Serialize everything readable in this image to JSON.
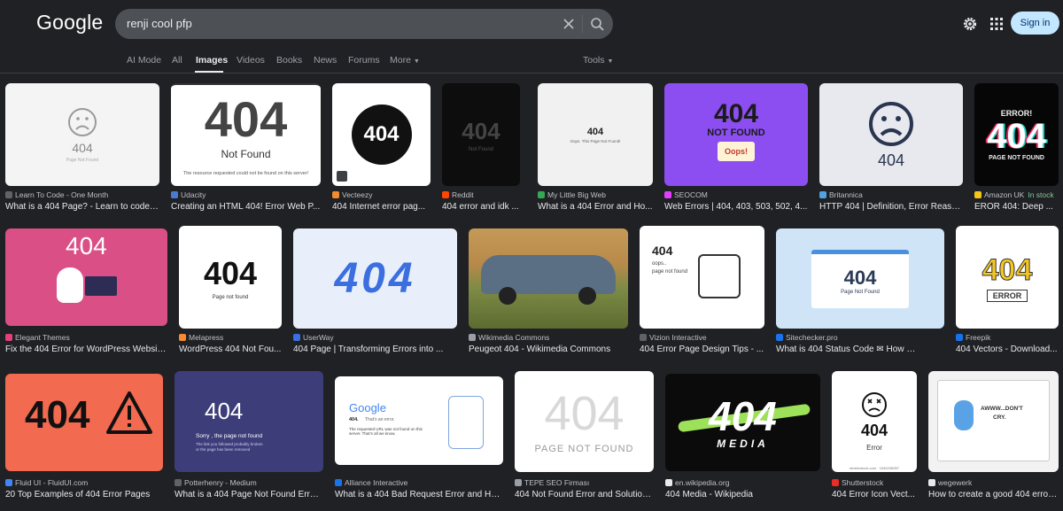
{
  "header": {
    "logo": "Google",
    "query": "renji cool pfp",
    "signin": "Sign in"
  },
  "tabs": [
    "AI Mode",
    "All",
    "Images",
    "Videos",
    "Books",
    "News",
    "Forums",
    "More",
    "Tools"
  ],
  "results": [
    {
      "source": "Learn To Code - One Month",
      "title": "What is a 404 Page? - Learn to code i...",
      "fav": "#5f6368",
      "thumb_text": [
        "404",
        "Page Not Found"
      ]
    },
    {
      "source": "Udacity",
      "title": "Creating an HTML 404! Error Web P...",
      "fav": "#4a7bd1",
      "thumb_text": [
        "404",
        "Not Found",
        "The resource requested could not be found on this server!"
      ]
    },
    {
      "source": "Vecteezy",
      "title": "404 Internet error pag...",
      "fav": "#f28b31",
      "thumb_text": [
        "404"
      ]
    },
    {
      "source": "Reddit",
      "title": "404 error and idk ...",
      "fav": "#ff4500",
      "thumb_text": [
        "404",
        "Not Found"
      ]
    },
    {
      "source": "My Little Big Web",
      "title": "What is a 404 Error and Ho...",
      "fav": "#34a853",
      "thumb_text": [
        "404",
        "Oops. This Page Not Found!"
      ]
    },
    {
      "source": "SEOCOM",
      "title": "Web Errors | 404, 403, 503, 502, 4...",
      "fav": "#e040fb",
      "thumb_text": [
        "404",
        "NOT FOUND",
        "Oops!"
      ]
    },
    {
      "source": "Britannica",
      "title": "HTTP 404 | Definition, Error Reaso...",
      "fav": "#4fa3e0",
      "thumb_text": [
        "404"
      ]
    },
    {
      "source": "Amazon UK",
      "stock": "In stock",
      "title": "EROR 404: Deep ...",
      "fav": "#f5c518",
      "thumb_text": [
        "ERROR!",
        "404",
        "PAGE NOT FOUND"
      ]
    },
    {
      "source": "Elegant Themes",
      "title": "Fix the 404 Error for WordPress Websites",
      "fav": "#e43f7a",
      "thumb_text": [
        "404"
      ]
    },
    {
      "source": "Melapress",
      "title": "WordPress 404 Not Fou...",
      "fav": "#f28b31",
      "thumb_text": [
        "404",
        "Page not found"
      ]
    },
    {
      "source": "UserWay",
      "title": "404 Page | Transforming Errors into ...",
      "fav": "#3b6fe0",
      "thumb_text": [
        "404"
      ]
    },
    {
      "source": "Wikimedia Commons",
      "title": "Peugeot 404 - Wikimedia Commons",
      "fav": "#9aa0a6",
      "thumb_text": []
    },
    {
      "source": "Vizion Interactive",
      "title": "404 Error Page Design Tips - ...",
      "fav": "#5f6368",
      "thumb_text": [
        "404",
        "oops..",
        "page not found"
      ]
    },
    {
      "source": "Sitechecker.pro",
      "title": "What is 404 Status Code ✉ How to ...",
      "fav": "#1a73e8",
      "thumb_text": [
        "404",
        "Page Not Found"
      ]
    },
    {
      "source": "Freepik",
      "title": "404 Vectors - Download...",
      "fav": "#1273eb",
      "thumb_text": [
        "404",
        "ERROR"
      ]
    },
    {
      "source": "Fluid UI - FluidUI.com",
      "title": "20 Top Examples of 404 Error Pages",
      "fav": "#4285f4",
      "thumb_text": [
        "404"
      ]
    },
    {
      "source": "Potterhenry - Medium",
      "title": "What is a 404 Page Not Found Error...",
      "fav": "#5f6368",
      "thumb_text": [
        "404",
        "Sorry , the page not found",
        "The link you followed probably broken",
        "or the page has been removed"
      ]
    },
    {
      "source": "Alliance Interactive",
      "title": "What is a 404 Bad Request Error and Ho...",
      "fav": "#1a73e8",
      "thumb_text": [
        "Google",
        "404.",
        "That’s an error.",
        "The requested URL was not found on this server. That’s all we know."
      ]
    },
    {
      "source": "TEPE SEO Firması",
      "title": "404 Not Found Error and Solution...",
      "fav": "#9aa0a6",
      "thumb_text": [
        "404",
        "PAGE NOT FOUND"
      ]
    },
    {
      "source": "en.wikipedia.org",
      "title": "404 Media - Wikipedia",
      "fav": "#e8eaed",
      "thumb_text": [
        "404",
        "MEDIA"
      ]
    },
    {
      "source": "Shutterstock",
      "title": "404 Error Icon Vect...",
      "fav": "#ee2b24",
      "thumb_text": [
        "404",
        "Error",
        "shutterstock.com · 1545236057"
      ]
    },
    {
      "source": "wegewerk",
      "title": "How to create a good 404 error ...",
      "fav": "#e8eaed",
      "thumb_text": [
        "AWWW...DON'T",
        "CRY."
      ]
    }
  ]
}
